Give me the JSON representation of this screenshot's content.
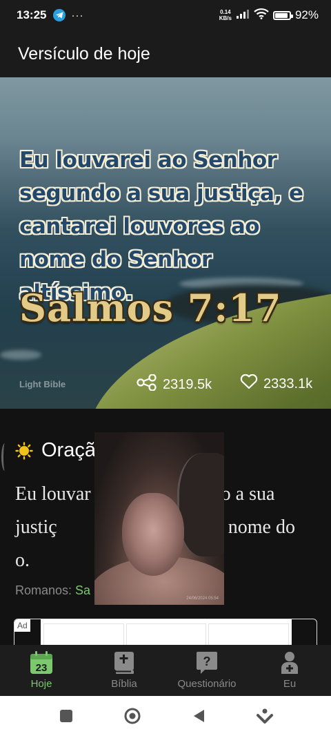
{
  "status_bar": {
    "time": "13:25",
    "overflow": "···",
    "net_speed_value": "0.14",
    "net_speed_unit": "KB/s",
    "battery": "92%",
    "battery_level": 0.92
  },
  "app_bar": {
    "title": "Versículo de hoje"
  },
  "hero": {
    "verse": "Eu louvarei ao Senhor segundo a sua justiça, e cantarei louvores ao nome do Senhor altíssimo.",
    "reference": "Salmos 7:17",
    "watermark": "Light Bible",
    "shares": "2319.5k",
    "likes": "2333.1k"
  },
  "devotion": {
    "title": "Oraçã",
    "body": "Eu louvar                   gundo a sua justiç                   uvores ao nome do                            o.",
    "ref_label": "Romanos: ",
    "ref_link": "Sa"
  },
  "ad": {
    "badge": "Ad"
  },
  "video": {
    "timestamp": "24/06/2024 05:54"
  },
  "bottom_nav": {
    "items": [
      {
        "label": "Hoje",
        "icon": "calendar-icon",
        "badge": "23",
        "active": true
      },
      {
        "label": "Bíblia",
        "icon": "bible-icon",
        "active": false
      },
      {
        "label": "Questionário",
        "icon": "quiz-icon",
        "active": false
      },
      {
        "label": "Eu",
        "icon": "person-icon",
        "active": false
      }
    ]
  },
  "colors": {
    "accent": "#7cc86f",
    "verse_text": "#23486a",
    "reference_text": "#e2cb88",
    "background": "#121212"
  }
}
